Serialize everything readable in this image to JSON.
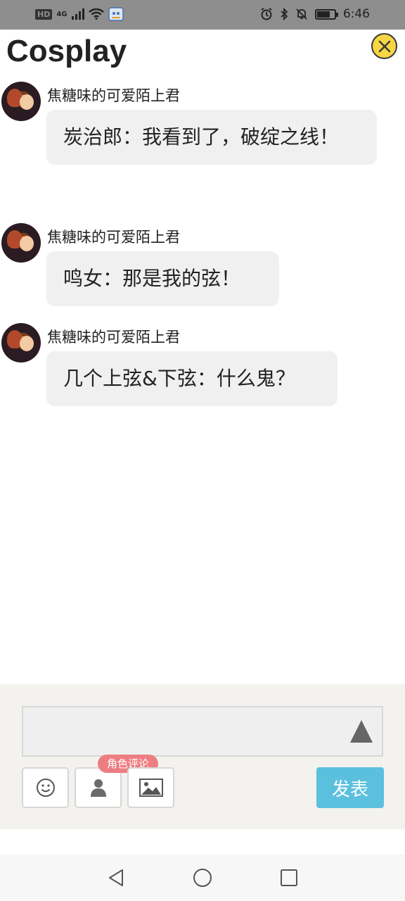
{
  "status_bar": {
    "network_badge": "HD",
    "signal_label": "4G",
    "time": "6:46",
    "icons": [
      "hd-icon",
      "signal-icon",
      "wifi-icon",
      "app-notification-icon",
      "alarm-icon",
      "bluetooth-icon",
      "mute-icon",
      "battery-icon"
    ]
  },
  "header": {
    "title": "Cosplay",
    "close_icon": "close-icon",
    "accent": "#f6d743"
  },
  "messages": [
    {
      "author": "焦糖味的可爱陌上君",
      "text": "炭治郎：我看到了，破绽之线！"
    },
    {
      "author": "焦糖味的可爱陌上君",
      "text": "鸣女：那是我的弦！"
    },
    {
      "author": "焦糖味的可爱陌上君",
      "text": "几个上弦&下弦：什么鬼？"
    }
  ],
  "composer": {
    "input_value": "",
    "send_icon": "triangle-up-icon",
    "tools": [
      {
        "icon": "smiley-icon"
      },
      {
        "icon": "person-icon",
        "tag": "角色评论"
      },
      {
        "icon": "image-icon"
      }
    ],
    "publish_label": "发表",
    "publish_color": "#5bc0de",
    "tag_color": "#ee7d82"
  },
  "nav_bar": {
    "buttons": [
      "back-icon",
      "home-icon",
      "recents-icon"
    ]
  }
}
